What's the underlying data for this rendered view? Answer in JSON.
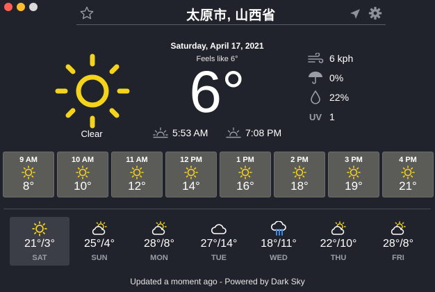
{
  "colors": {
    "background": "#20232b",
    "sun": "#f6d31b",
    "card": "#5b5c57",
    "rain": "#3b8cf0"
  },
  "header": {
    "city": "太原市, 山西省"
  },
  "current": {
    "date": "Saturday, April 17, 2021",
    "feels_like": "Feels like 6°",
    "temperature": "6°",
    "condition": "Clear",
    "sunrise": "5:53 AM",
    "sunset": "7:08 PM",
    "wind": "6 kph",
    "precipitation": "0%",
    "humidity": "22%",
    "uv_label": "UV",
    "uv": "1"
  },
  "hourly": [
    {
      "time": "9 AM",
      "temp": "8°",
      "icon": "sun-icon"
    },
    {
      "time": "10 AM",
      "temp": "10°",
      "icon": "sun-icon"
    },
    {
      "time": "11 AM",
      "temp": "12°",
      "icon": "sun-icon"
    },
    {
      "time": "12 PM",
      "temp": "14°",
      "icon": "sun-icon"
    },
    {
      "time": "1 PM",
      "temp": "16°",
      "icon": "sun-icon"
    },
    {
      "time": "2 PM",
      "temp": "18°",
      "icon": "sun-icon"
    },
    {
      "time": "3 PM",
      "temp": "19°",
      "icon": "sun-icon"
    },
    {
      "time": "4 PM",
      "temp": "21°",
      "icon": "sun-icon"
    }
  ],
  "daily": [
    {
      "day": "SAT",
      "temp": "21°/3°",
      "icon": "sun-icon"
    },
    {
      "day": "SUN",
      "temp": "25°/4°",
      "icon": "partly-cloudy-icon"
    },
    {
      "day": "MON",
      "temp": "28°/8°",
      "icon": "partly-cloudy-icon"
    },
    {
      "day": "TUE",
      "temp": "27°/14°",
      "icon": "cloud-icon"
    },
    {
      "day": "WED",
      "temp": "18°/11°",
      "icon": "rain-icon"
    },
    {
      "day": "THU",
      "temp": "22°/10°",
      "icon": "partly-cloudy-icon"
    },
    {
      "day": "FRI",
      "temp": "28°/8°",
      "icon": "partly-cloudy-icon"
    }
  ],
  "footer": {
    "text": "Updated a moment ago - Powered by Dark Sky"
  }
}
